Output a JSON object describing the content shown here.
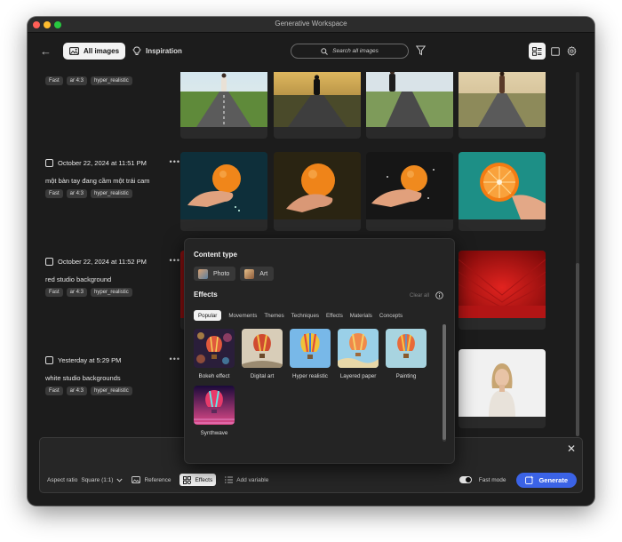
{
  "window": {
    "title": "Generative Workspace"
  },
  "topbar": {
    "all_images_label": "All images",
    "inspiration_label": "Inspiration",
    "search_placeholder": "Search all images"
  },
  "history": [
    {
      "date": "",
      "prompt": "",
      "tags": [
        "Fast",
        "ar 4:3",
        "hyper_realistic"
      ]
    },
    {
      "date": "October 22, 2024 at 11:51 PM",
      "prompt": "một bàn tay đang cầm một trái cam",
      "tags": [
        "Fast",
        "ar 4:3",
        "hyper_realistic"
      ]
    },
    {
      "date": "October 22, 2024 at 11:52 PM",
      "prompt": "red studio background",
      "tags": [
        "Fast",
        "ar 4:3",
        "hyper_realistic"
      ]
    },
    {
      "date": "Yesterday at 5:29 PM",
      "prompt": "white studio backgrounds",
      "tags": [
        "Fast",
        "ar 4:3",
        "hyper_realistic"
      ]
    }
  ],
  "effects_panel": {
    "content_type_title": "Content type",
    "content_types": [
      "Photo",
      "Art"
    ],
    "effects_title": "Effects",
    "clear_all": "Clear all",
    "tabs": [
      "Popular",
      "Movements",
      "Themes",
      "Techniques",
      "Effects",
      "Materials",
      "Concepts"
    ],
    "effects": [
      "Bokeh effect",
      "Digital art",
      "Hyper realistic",
      "Layered paper",
      "Painting",
      "Synthwave"
    ]
  },
  "bottom_bar": {
    "aspect_ratio_label": "Aspect ratio",
    "aspect_ratio_value": "Square (1:1)",
    "reference_label": "Reference",
    "effects_label": "Effects",
    "add_variable_label": "Add variable",
    "fast_mode_label": "Fast mode",
    "generate_label": "Generate"
  },
  "colors": {
    "accent": "#3b63e6",
    "background": "#1c1c1c",
    "panel": "#242424"
  }
}
